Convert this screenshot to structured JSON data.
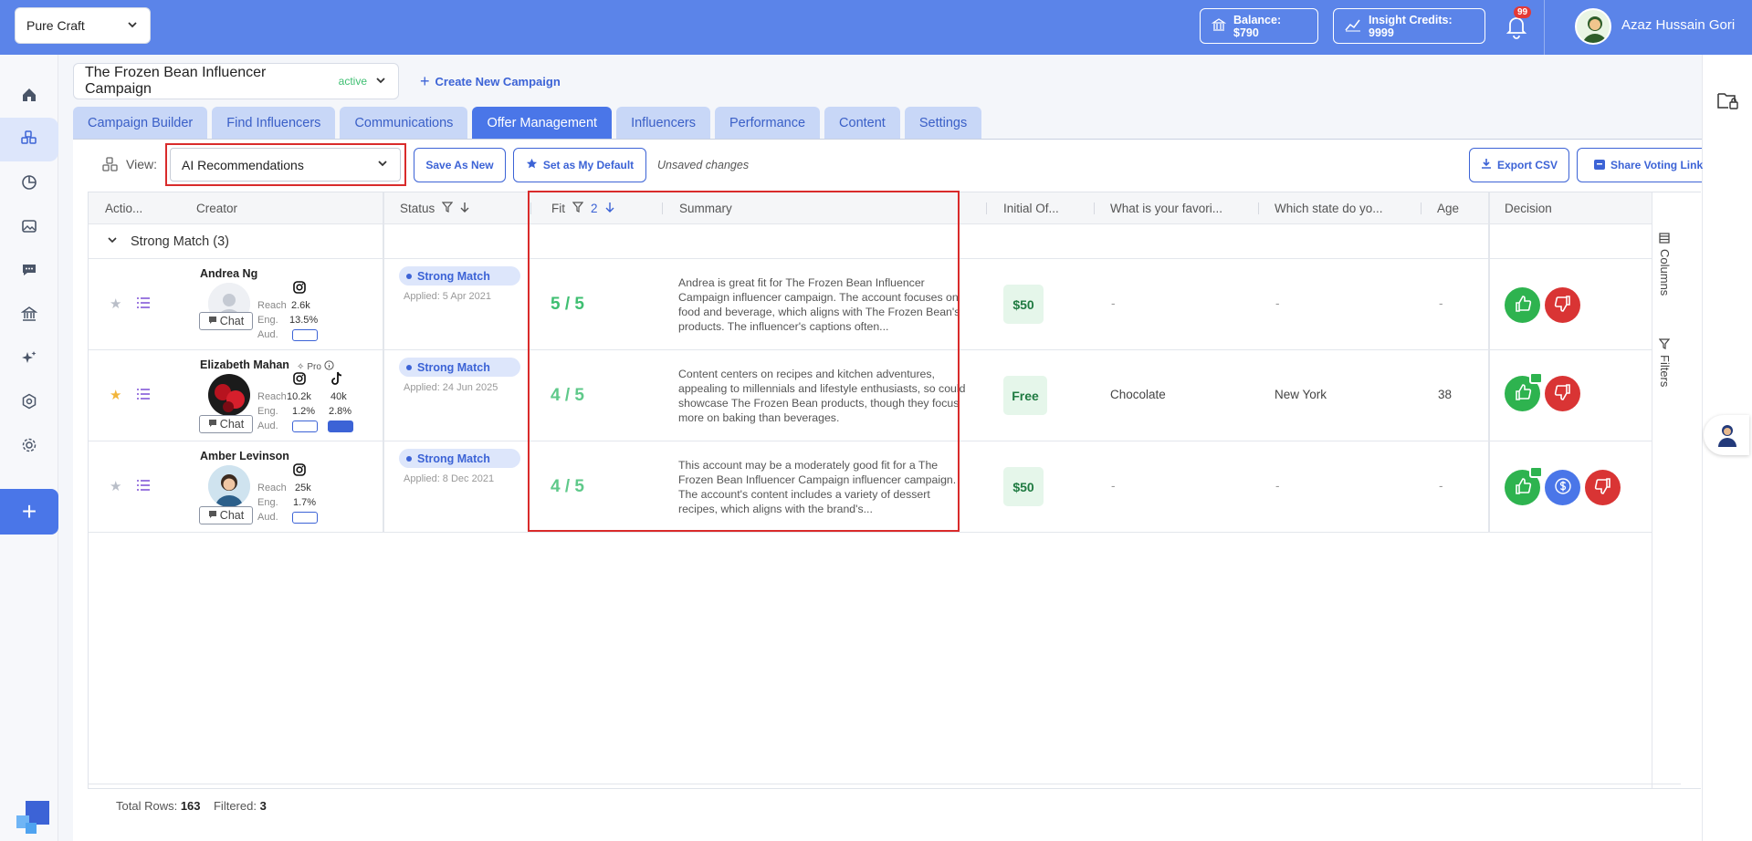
{
  "topbar": {
    "workspace": "Pure Craft",
    "balance": "Balance: $790",
    "credits": "Insight Credits: 9999",
    "notifications_count": "99",
    "user_name": "Azaz Hussain Gori"
  },
  "campaign": {
    "name": "The Frozen Bean Influencer Campaign",
    "status": "active",
    "create_label": "Create New Campaign"
  },
  "tabs": [
    {
      "label": "Campaign Builder",
      "active": false
    },
    {
      "label": "Find Influencers",
      "active": false
    },
    {
      "label": "Communications",
      "active": false
    },
    {
      "label": "Offer Management",
      "active": true
    },
    {
      "label": "Influencers",
      "active": false
    },
    {
      "label": "Performance",
      "active": false
    },
    {
      "label": "Content",
      "active": false
    },
    {
      "label": "Settings",
      "active": false
    }
  ],
  "toolbar": {
    "view_label": "View:",
    "view_value": "AI Recommendations",
    "save_as_new": "Save As New",
    "set_default": "Set as My Default",
    "unsaved": "Unsaved changes",
    "export_csv": "Export CSV",
    "share_link": "Share Voting Link"
  },
  "grid": {
    "headers": {
      "actions": "Actio...",
      "creator": "Creator",
      "status": "Status",
      "fit": "Fit",
      "fit_sort_index": "2",
      "summary": "Summary",
      "initial_offer": "Initial Of...",
      "favorite": "What is your favori...",
      "state": "Which state do yo...",
      "age": "Age",
      "decision": "Decision"
    },
    "group_label": "Strong Match (3)",
    "side_tabs": {
      "columns": "Columns",
      "filters": "Filters"
    },
    "metric_labels": {
      "reach": "Reach",
      "eng": "Eng.",
      "aud": "Aud."
    },
    "chat_label": "Chat",
    "pro_label": "Pro",
    "rows": [
      {
        "name": "Andrea Ng",
        "starred": false,
        "reach": [
          "2.6k"
        ],
        "eng": [
          "13.5%"
        ],
        "status": "Strong Match",
        "applied": "Applied: 5 Apr 2021",
        "fit": "5 / 5",
        "summary": "Andrea is great fit for The Frozen Bean Influencer Campaign influencer campaign. The account focuses on food and beverage, which aligns with The Frozen Bean's products. The influencer's captions often...",
        "offer": "$50",
        "favorite": "-",
        "state": "-",
        "age": "-"
      },
      {
        "name": "Elizabeth Mahan",
        "starred": true,
        "reach": [
          "10.2k",
          "40k"
        ],
        "eng": [
          "1.2%",
          "2.8%"
        ],
        "status": "Strong Match",
        "applied": "Applied: 24 Jun 2025",
        "fit": "4 / 5",
        "summary": "Content centers on recipes and kitchen adventures, appealing to millennials and lifestyle enthusiasts, so could showcase The Frozen Bean products, though they focus more on baking than beverages.",
        "offer": "Free",
        "favorite": "Chocolate",
        "state": "New York",
        "age": "38"
      },
      {
        "name": "Amber Levinson",
        "starred": false,
        "reach": [
          "25k"
        ],
        "eng": [
          "1.7%"
        ],
        "status": "Strong Match",
        "applied": "Applied: 8 Dec 2021",
        "fit": "4 / 5",
        "summary": "This account may be a moderately good fit for a The Frozen Bean Influencer Campaign influencer campaign. The account's content includes a variety of dessert recipes, which aligns with the brand's...",
        "offer": "$50",
        "favorite": "-",
        "state": "-",
        "age": "-"
      }
    ]
  },
  "totals": {
    "total_label": "Total Rows:",
    "total": "163",
    "filtered_label": "Filtered:",
    "filtered": "3"
  },
  "colors": {
    "primary": "#5b84e9",
    "accent": "#3c63d6",
    "fit_green": "#4cc476",
    "approve": "#2eb34f",
    "reject": "#d93434",
    "highlight": "#d92b2b"
  }
}
